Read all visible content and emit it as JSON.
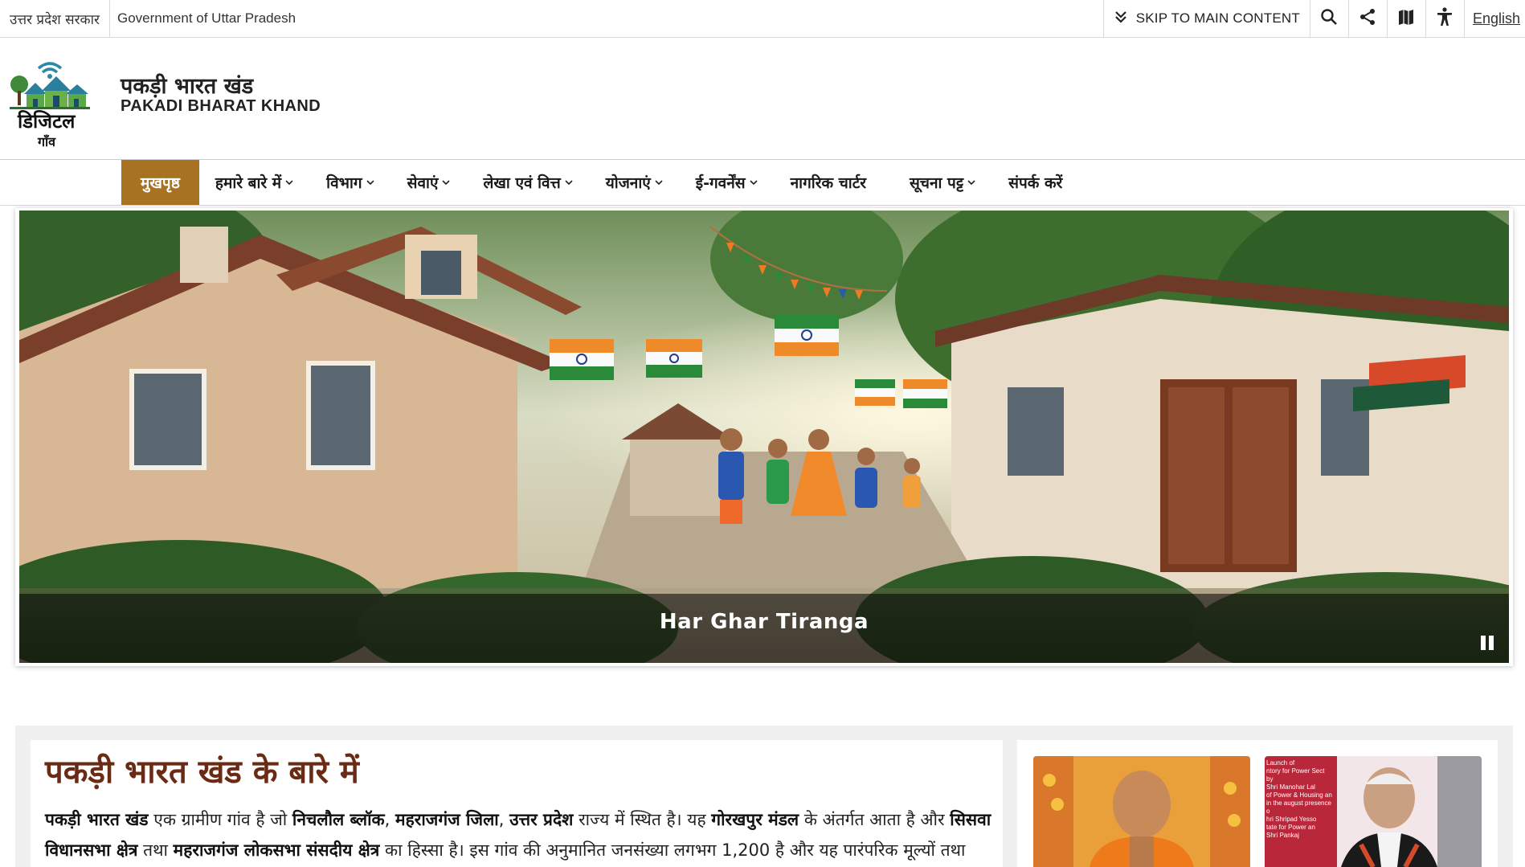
{
  "topbar": {
    "gov_hindi": "उत्तर प्रदेश सरकार",
    "gov_english": "Government of Uttar Pradesh",
    "skip_label": "SKIP TO MAIN CONTENT",
    "tools": [
      "search-icon",
      "share-icon",
      "sitemap-icon",
      "accessibility-icon"
    ],
    "language_label": "English"
  },
  "header": {
    "logo_text": "डिजिटल",
    "logo_subtext": "गाँव",
    "title_hindi": "पकड़ी भारत खंड",
    "title_english": "PAKADI BHARAT KHAND"
  },
  "nav": {
    "items": [
      {
        "label": "मुखपृष्ठ",
        "active": true,
        "dropdown": false
      },
      {
        "label": "हमारे बारे में",
        "dropdown": true
      },
      {
        "label": "विभाग",
        "dropdown": true
      },
      {
        "label": "सेवाएं",
        "dropdown": true
      },
      {
        "label": "लेखा एवं वित्त",
        "dropdown": true
      },
      {
        "label": "योजनाएं",
        "dropdown": true
      },
      {
        "label": "ई-गवर्नेंस",
        "dropdown": true
      },
      {
        "label": "नागरिक चार्टर",
        "dropdown": false
      },
      {
        "label": "सूचना पट्ट",
        "dropdown": true
      },
      {
        "label": "संपर्क करें",
        "dropdown": false
      }
    ]
  },
  "hero": {
    "caption": "Har Ghar Tiranga",
    "control": "pause-icon"
  },
  "about": {
    "title": "पकड़ी भारत खंड के बारे में",
    "p_village": "पकड़ी भारत खंड",
    "p_t1": " एक ग्रामीण गांव है जो ",
    "p_block": "निचलौल ब्लॉक",
    "p_comma1": ", ",
    "p_district": "महराजगंज जिला",
    "p_comma2": ", ",
    "p_state": "उत्तर प्रदेश",
    "p_t2": " राज्य में स्थित है। यह ",
    "p_mandal": "गोरखपुर मंडल",
    "p_t3": " के अंतर्गत आता है और ",
    "p_assembly": "सिसवा विधानसभा क्षेत्र",
    "p_t4": " तथा ",
    "p_loksabha": "महराजगंज लोकसभा संसदीय क्षेत्र",
    "p_t5": " का हिस्सा है। इस गांव की अनुमानित जनसंख्या लगभग 1,200 है और यह पारंपरिक मूल्यों तथा उभरते"
  },
  "side_photos": {
    "photo2_lines": [
      "Launch of",
      "ntory for Power Sect",
      "by",
      "Shri Manohar Lal",
      "of Power & Housing an",
      "in the august presence o",
      "hri Shripad Yesso",
      "tate for Power an",
      "Shri Pankaj"
    ]
  }
}
